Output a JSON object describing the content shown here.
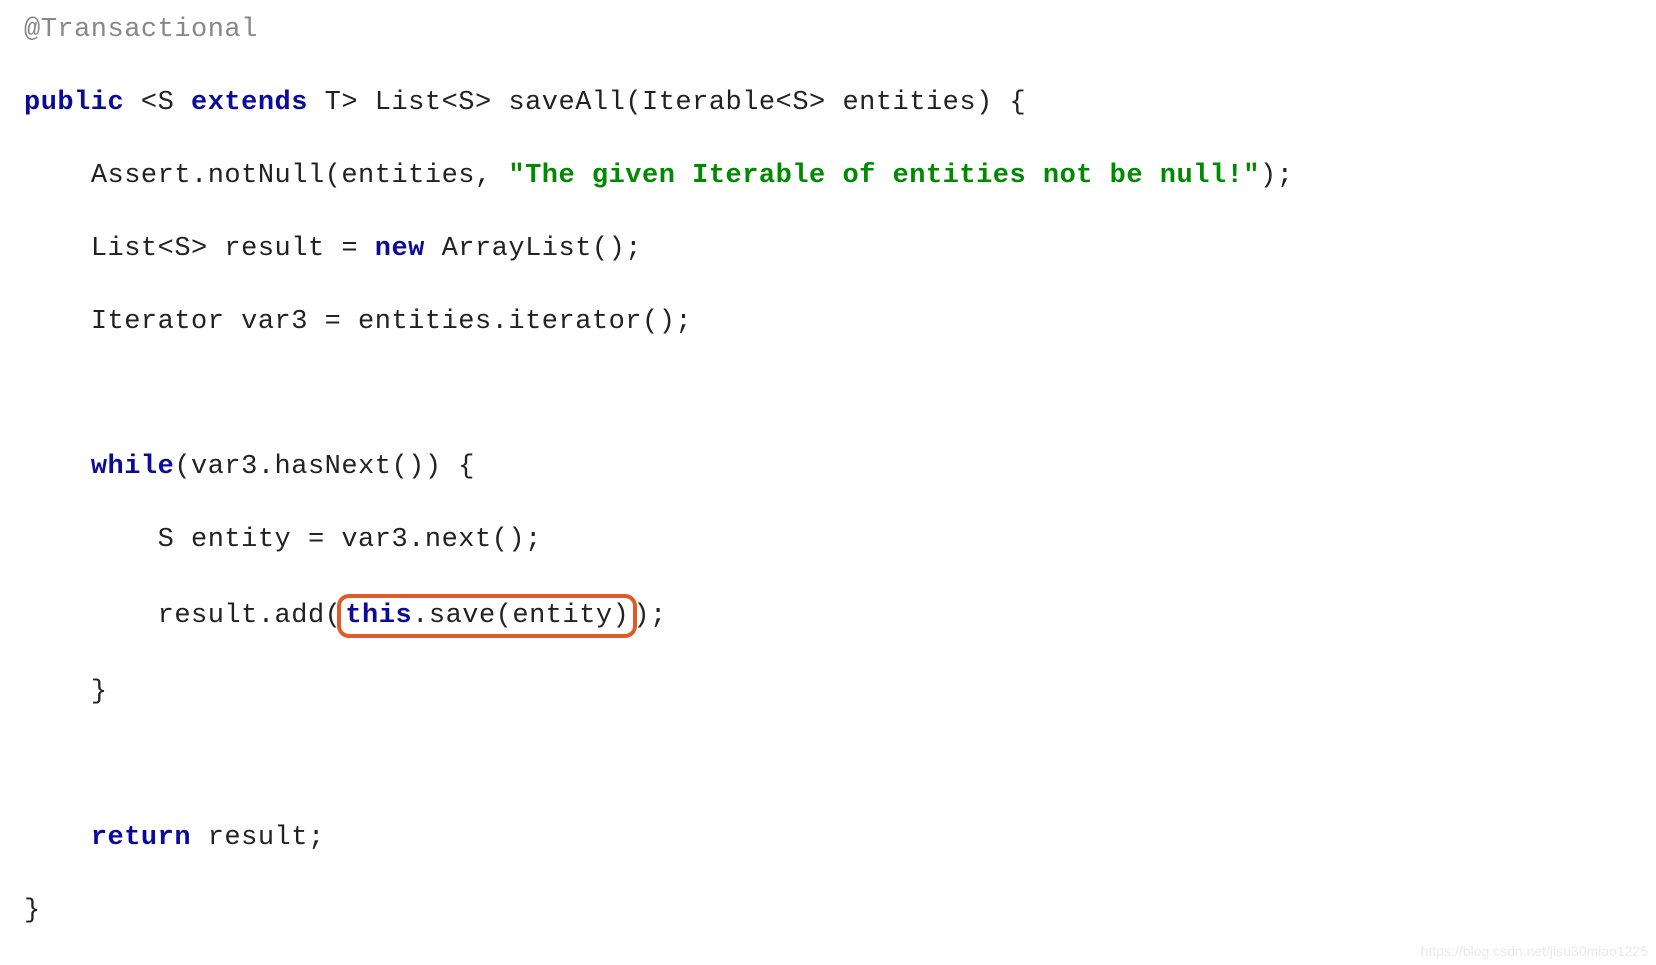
{
  "code": {
    "annotation": "@Transactional",
    "kw_public": "public",
    "kw_extends": "extends",
    "kw_new": "new",
    "kw_while": "while",
    "kw_return": "return",
    "kw_this": "this",
    "generic_open": "<S ",
    "generic_t": "T> ",
    "ret_type": "List<S> ",
    "method_name": "saveAll",
    "param_type": "(Iterable<S> ",
    "param_name": "entities) {",
    "assert_call": "Assert.notNull(entities, ",
    "assert_msg": "\"The given Iterable of entities not be null!\"",
    "assert_end": ");",
    "list_decl_left": "List<S> result = ",
    "arraylist": " ArrayList();",
    "iter_decl": "Iterator var3 = entities.iterator();",
    "while_cond": "(var3.hasNext()) {",
    "entity_assign": "S entity = var3.next();",
    "result_add_pre": "result.add(",
    "this_save": ".save(entity)",
    "result_add_post": ");",
    "close_while": "}",
    "return_val": " result;",
    "close_method": "}"
  },
  "indent1": "    ",
  "indent2": "        ",
  "watermark": "https://blog.csdn.net/jisu30miao1225"
}
